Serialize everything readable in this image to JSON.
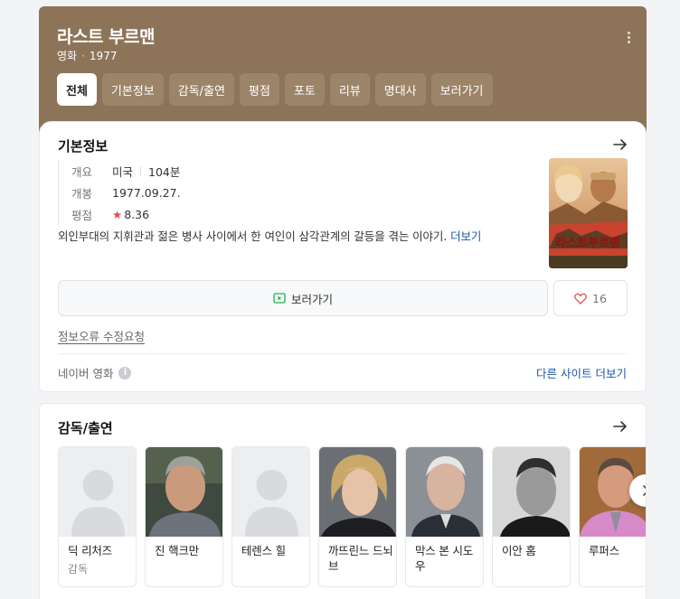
{
  "header": {
    "title": "라스트 부르맨",
    "type": "영화",
    "year": "1977",
    "tabs": [
      {
        "label": "전체",
        "active": true
      },
      {
        "label": "기본정보"
      },
      {
        "label": "감독/출연"
      },
      {
        "label": "평점"
      },
      {
        "label": "포토"
      },
      {
        "label": "리뷰"
      },
      {
        "label": "명대사"
      },
      {
        "label": "보러가기"
      }
    ]
  },
  "basic_info": {
    "title": "기본정보",
    "overview_label": "개요",
    "country": "미국",
    "runtime": "104분",
    "release_label": "개봉",
    "release_date": "1977.09.27.",
    "rating_label": "평점",
    "rating_star": "★",
    "rating": "8.36",
    "description": "외인부대의 지휘관과 젊은 병사 사이에서 한 여인이 삼각관계의 갈등을 겪는 이야기.",
    "more_label": "더보기",
    "poster_text": "라스트부르맨",
    "watch_label": "보러가기",
    "like_count": "16",
    "error_report": "정보오류 수정요청",
    "source": "네이버 영화",
    "other_sites": "다른 사이트 더보기",
    "icons": {
      "arrow": "arrow-right-icon",
      "heart": "heart-icon",
      "watch": "play-screen-icon",
      "info": "info-icon"
    }
  },
  "cast_section": {
    "title": "감독/출연",
    "people": [
      {
        "name": "딕 리처즈",
        "role": "감독",
        "photo": false
      },
      {
        "name": "진 핵크만",
        "role": "",
        "photo": true
      },
      {
        "name": "테렌스 힐",
        "role": "",
        "photo": false
      },
      {
        "name": "까뜨린느 드뇌브",
        "role": "",
        "photo": true
      },
      {
        "name": "막스 본 시도우",
        "role": "",
        "photo": true
      },
      {
        "name": "이안 홈",
        "role": "",
        "photo": true
      },
      {
        "name": "루퍼스",
        "role": "",
        "photo": true
      }
    ]
  },
  "colors": {
    "header_bg": "#8d7459",
    "tab_bg": "#9c8468",
    "link": "#1b55a8",
    "star": "#ef4a52",
    "watch_icon": "#22b24c"
  }
}
